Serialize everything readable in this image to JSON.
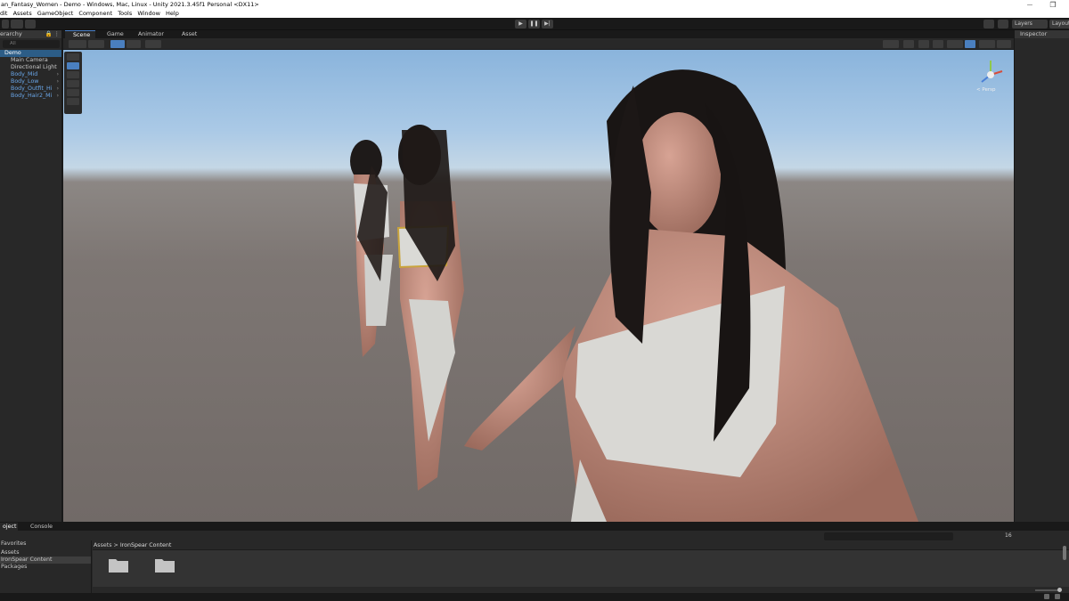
{
  "window": {
    "title": "an_Fantasy_Women - Demo - Windows, Mac, Linux - Unity 2021.3.45f1 Personal <DX11>",
    "min": "—",
    "max": "❐"
  },
  "menu": [
    "dit",
    "Assets",
    "GameObject",
    "Component",
    "Tools",
    "Window",
    "Help"
  ],
  "toolbar": {
    "play": "▶",
    "pause": "❚❚",
    "step": "▶|",
    "layers": "Layers",
    "layout": "Layout"
  },
  "hierarchy": {
    "tab": "erarchy",
    "search_placeholder": "All",
    "root": "Demo",
    "children": [
      "Main Camera",
      "Directional Light"
    ],
    "prefabs": [
      "Body_Mid",
      "Body_Low",
      "Body_Outfit_Hi",
      "Body_Hair2_Mi"
    ]
  },
  "scene": {
    "tabs": [
      "Scene",
      "Game",
      "Animator",
      "Asset Store"
    ],
    "gizmo_label": "< Persp"
  },
  "inspector": {
    "tab": "Inspector"
  },
  "project": {
    "tabs": [
      "oject",
      "Console"
    ],
    "tree": [
      "Favorites",
      "Assets",
      "IronSpear Content",
      "Packages"
    ],
    "breadcrumb": [
      "Assets",
      "IronSpear Content"
    ],
    "breadcrumb_sep": ">",
    "count": "16"
  }
}
